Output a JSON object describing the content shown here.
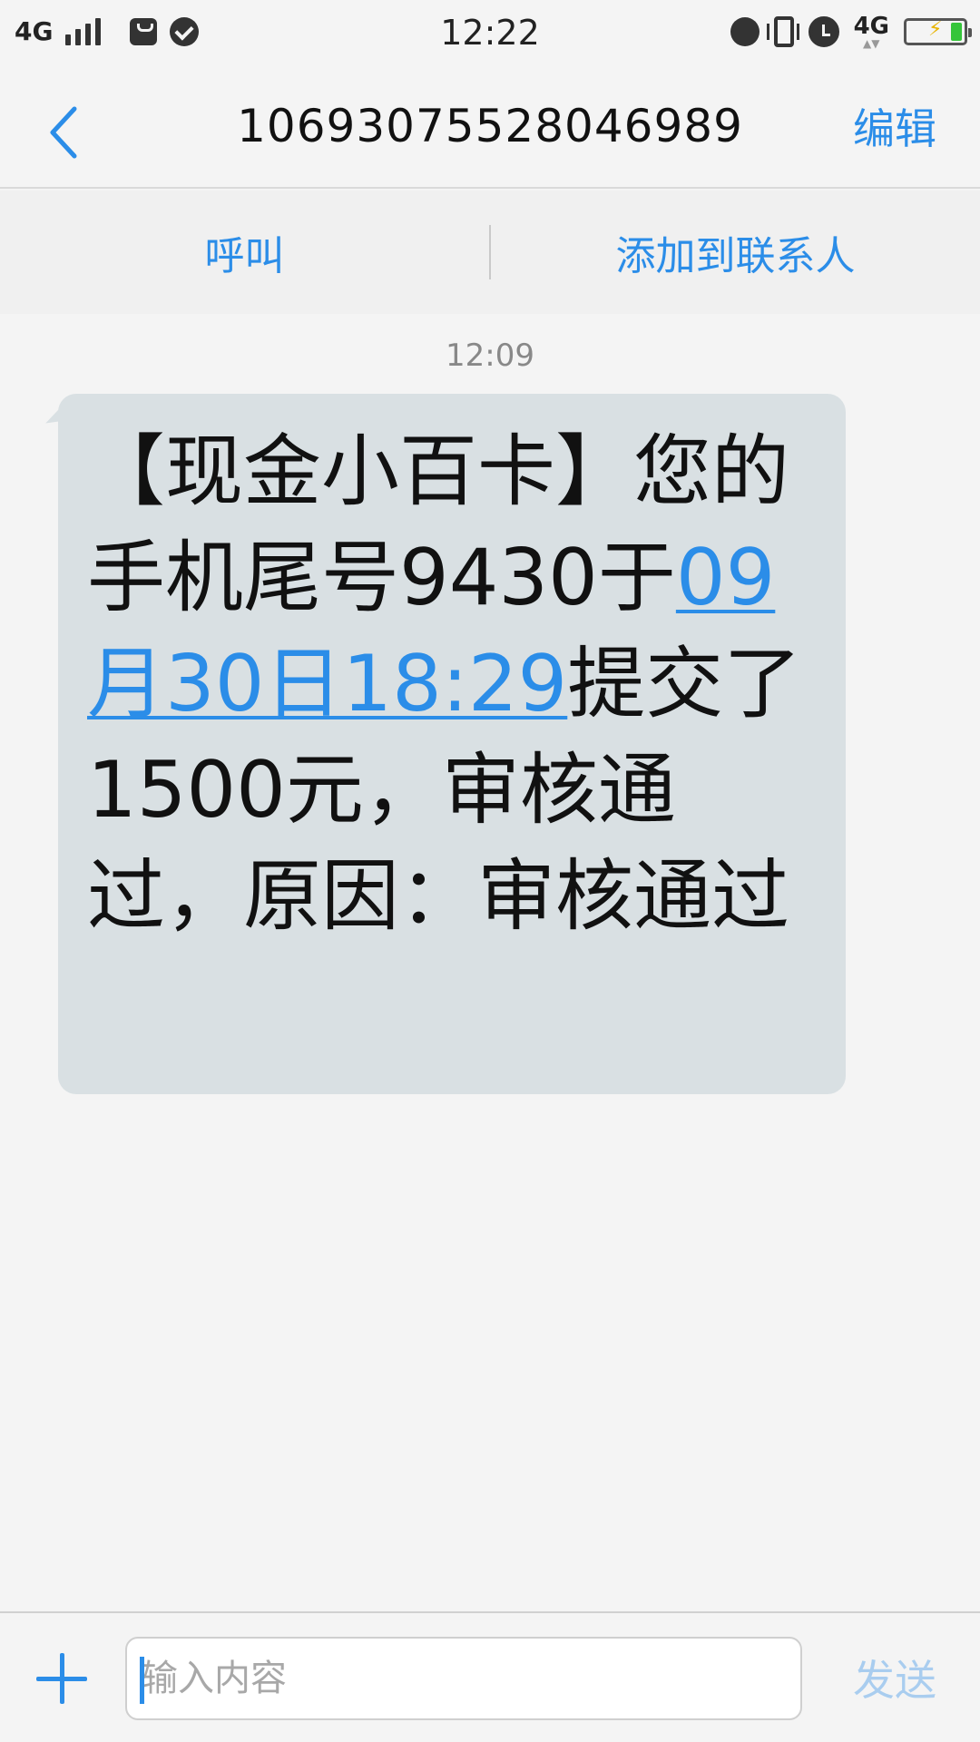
{
  "status_bar": {
    "network": "4G",
    "time": "12:22",
    "network_right": "4G",
    "battery_color": "#35c53a"
  },
  "header": {
    "back_icon": "chevron-left-icon",
    "title": "10693075528046989",
    "edit_label": "编辑"
  },
  "actions": {
    "call_label": "呼叫",
    "add_contact_label": "添加到联系人"
  },
  "conversation": {
    "timestamp": "12:09",
    "message": {
      "text_before": "【现金小百卡】您的手机尾号9430于",
      "link_text": "09月30日18:29",
      "text_after": "提交了1500元，审核通过，原因：审核通过"
    }
  },
  "composer": {
    "add_icon": "plus-icon",
    "placeholder": "输入内容",
    "send_label": "发送"
  },
  "colors": {
    "accent": "#2b8de8",
    "bubble": "#d9e0e3",
    "send_disabled": "#a9cdef"
  }
}
